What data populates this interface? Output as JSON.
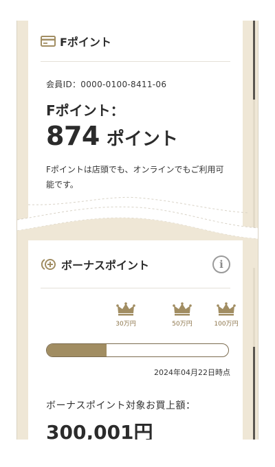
{
  "f_point_card": {
    "title": "Fポイント",
    "icon": "card-icon",
    "member_id": "会員ID：0000-0100-8411-06",
    "points_label": "Fポイント：",
    "points_value": "874",
    "points_unit": "ポイント",
    "note": "Fポイントは店頭でも、オンラインでもご利用可能です。"
  },
  "bonus_card": {
    "title": "ボーナスポイント",
    "icon": "bonus-plus-icon",
    "info_icon": "info-icon",
    "tiers": [
      {
        "label": "30万円",
        "icon": "crown-icon"
      },
      {
        "label": "50万円",
        "icon": "crown-icon"
      },
      {
        "label": "100万円",
        "icon": "crown-icon"
      }
    ],
    "progress_fraction": 0.33,
    "as_of": "2024年04月22日時点",
    "purchase_label": "ボーナスポイント対象お買上額：",
    "purchase_amount": "300,001円"
  },
  "colors": {
    "accent": "#a18d62",
    "background_frame": "#efe7d6",
    "tier_text": "#8b7348"
  }
}
